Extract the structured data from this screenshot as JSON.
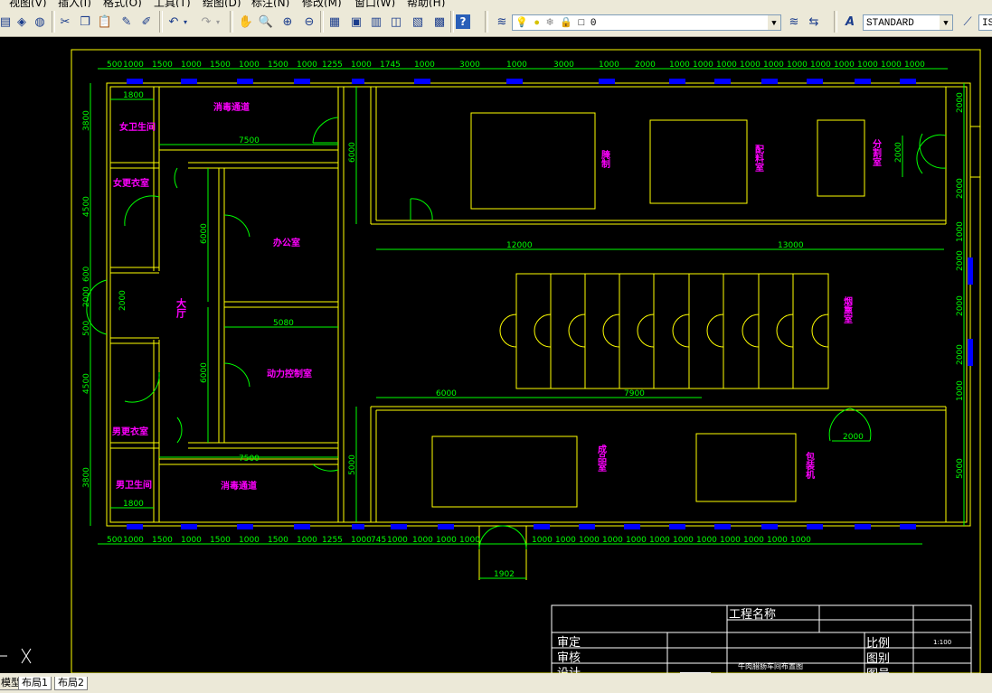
{
  "menu": {
    "items": [
      "视图(V)",
      "插入(I)",
      "格式(O)",
      "工具(T)",
      "绘图(D)",
      "标注(N)",
      "修改(M)",
      "窗口(W)",
      "帮助(H)"
    ]
  },
  "toolbar": {
    "layer_value": "0",
    "text_style": "STANDARD",
    "dim_style_partial": "IS"
  },
  "tabs": [
    "模型",
    "布局1",
    "布局2"
  ],
  "drawing": {
    "dims_top": [
      "500",
      "1000",
      "1500",
      "1000",
      "1500",
      "1000",
      "1500",
      "1000",
      "1255",
      "1000",
      "1745",
      "1000",
      "3000",
      "1000",
      "3000",
      "1000",
      "2000",
      "1000",
      "1000",
      "1000",
      "1000",
      "1000",
      "1000",
      "1000",
      "1000",
      "1000",
      "1000",
      "1000"
    ],
    "dims_bottom": [
      "500",
      "1000",
      "1500",
      "1000",
      "1500",
      "1000",
      "1500",
      "1000",
      "1255",
      "1000",
      "745",
      "1000",
      "1000",
      "1000",
      "1000",
      "1000",
      "1000",
      "1000",
      "1000",
      "1000",
      "1000",
      "1000",
      "1000",
      "1000",
      "1000",
      "1000",
      "1000"
    ],
    "dims_left": [
      "3800",
      "4500",
      "600",
      "2000",
      "500",
      "4500",
      "3800"
    ],
    "dims_right": [
      "2000",
      "2000",
      "1000",
      "2000",
      "2000",
      "2000",
      "1000",
      "5000"
    ],
    "dim_bottom_door": "1902",
    "dim_female_row": "1800",
    "dim_male_row": "1800",
    "dim_corridor_top": "7500",
    "dim_corridor_bottom": "7500",
    "dim_office_v": "6000",
    "dim_power_v": "6000",
    "dim_mid_h": "5080",
    "dim_left_door": "2000",
    "dim_row_12000": "12000",
    "dim_row_13000": "13000",
    "dim_upper_v": "6000",
    "dim_door_right": "2000",
    "dim_lower_6000": "6000",
    "dim_lower_7900": "7900",
    "dim_lower_v": "5000",
    "dim_pack_door": "2000",
    "rooms": {
      "female_wc": "女卫生间",
      "female_locker": "女更衣室",
      "disinfect_top": "消毒通道",
      "disinfect_bottom": "消毒通道",
      "office": "办公室",
      "hall": "大厅",
      "power": "动力控制室",
      "male_locker": "男更衣室",
      "male_wc": "男卫生间",
      "marinate": "腌制",
      "ingredients": "配料室",
      "split": "分割室",
      "smoke": "烟熏室",
      "finished": "成品室",
      "pack": "包装机"
    }
  },
  "titleblock": {
    "project_label": "工程名称",
    "review1": "审定",
    "review2": "审核",
    "design": "设计",
    "drawing_title": "牛肉腊肠车间布置图",
    "scale_label": "比例",
    "scale_value": "1:100",
    "type_label": "图别",
    "number_label": "图号"
  },
  "colors": {
    "wall": "#ffff00",
    "dim": "#00ff00",
    "equipment": "#ffff00",
    "text_room": "#ff00ff",
    "door": "#00ff00",
    "white": "#ffffff",
    "blue_marker": "#0000ff"
  }
}
